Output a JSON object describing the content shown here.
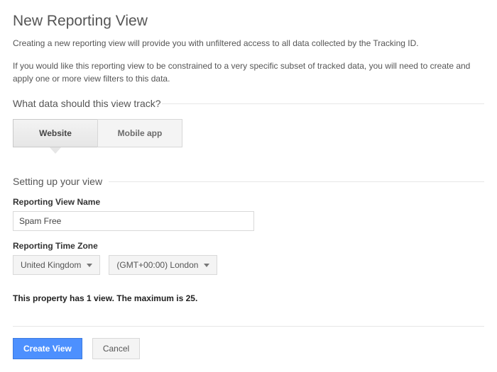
{
  "title": "New Reporting View",
  "intro1": "Creating a new reporting view will provide you with unfiltered access to all data collected by the Tracking ID.",
  "intro2": "If you would like this reporting view to be constrained to a very specific subset of tracked data, you will need to create and apply one or more view filters to this data.",
  "section1": "What data should this view track?",
  "tabs": {
    "website": "Website",
    "mobile": "Mobile app"
  },
  "section2": "Setting up your view",
  "name_label": "Reporting View Name",
  "name_value": "Spam Free",
  "tz_label": "Reporting Time Zone",
  "tz_country": "United Kingdom",
  "tz_zone": "(GMT+00:00) London",
  "max_note": "This property has 1 view. The maximum is 25.",
  "buttons": {
    "create": "Create View",
    "cancel": "Cancel"
  }
}
